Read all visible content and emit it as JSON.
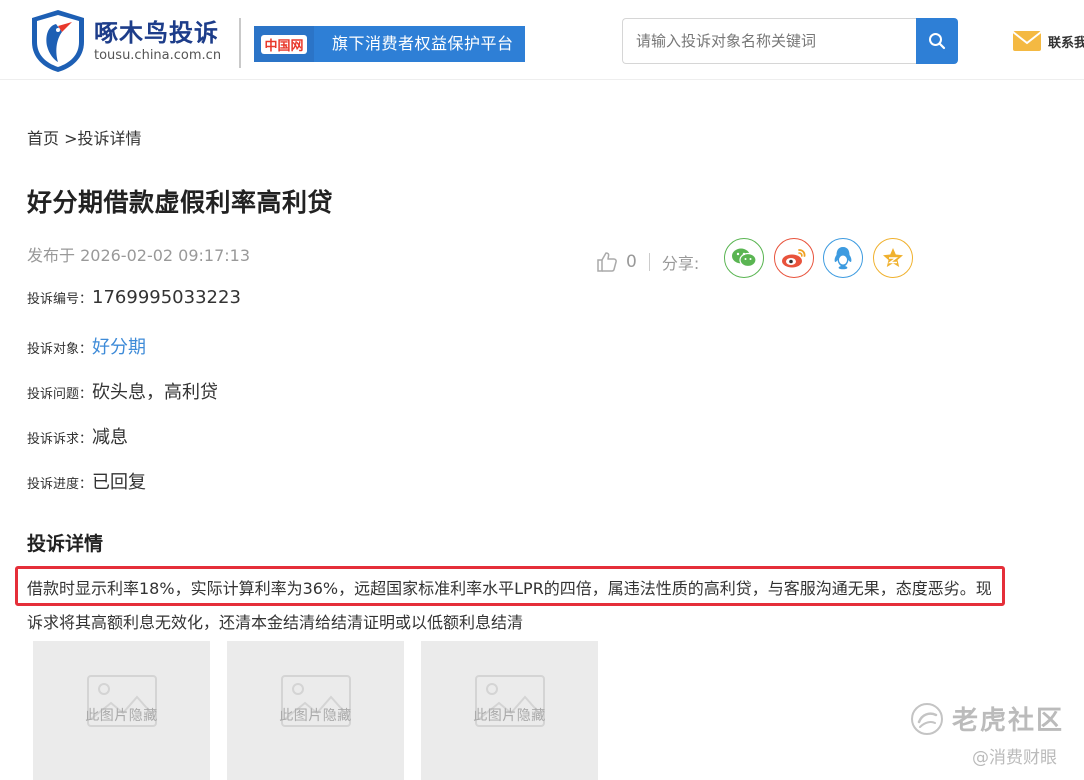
{
  "header": {
    "logo_name": "啄木鸟投诉",
    "logo_domain": "tousu.china.com.cn",
    "partner_logo": "中国网",
    "partner_text": "旗下消费者权益保护平台",
    "search_placeholder": "请输入投诉对象名称关键词",
    "contact_label": "联系我"
  },
  "breadcrumb": "首页 >投诉详情",
  "complaint": {
    "title": "好分期借款虚假利率高利贷",
    "published": "发布于 2026-02-02 09:17:13",
    "likes": "0",
    "share_label": "分享:",
    "fields": [
      {
        "label": "投诉编号：",
        "value": "1769995033223"
      },
      {
        "label": "投诉对象：",
        "value": "好分期"
      },
      {
        "label": "投诉问题：",
        "value": "砍头息，高利贷"
      },
      {
        "label": "投诉诉求：",
        "value": "减息"
      },
      {
        "label": "投诉进度：",
        "value": "已回复"
      }
    ],
    "detail_heading": "投诉详情",
    "detail_line1": "借款时显示利率18%，实际计算利率为36%，远超国家标准利率水平LPR的四倍，属违法性质的高利贷，与客服沟通无果，态度恶劣。现",
    "detail_line2": "诉求将其高额利息无效化，还清本金结清给结清证明或以低额利息结清",
    "hidden_image_text": "此图片隐藏"
  },
  "watermark": {
    "name": "老虎社区",
    "sub": "@消费财眼"
  },
  "colors": {
    "brand_blue": "#2e7fd6",
    "link_blue": "#3e8bd8",
    "highlight_red": "#e52f39"
  },
  "icons": [
    "shield-woodpecker-logo",
    "search-icon",
    "mail-icon",
    "thumbs-up-icon",
    "wechat-icon",
    "weibo-icon",
    "qq-icon",
    "qzone-star-icon",
    "image-placeholder-icon"
  ]
}
